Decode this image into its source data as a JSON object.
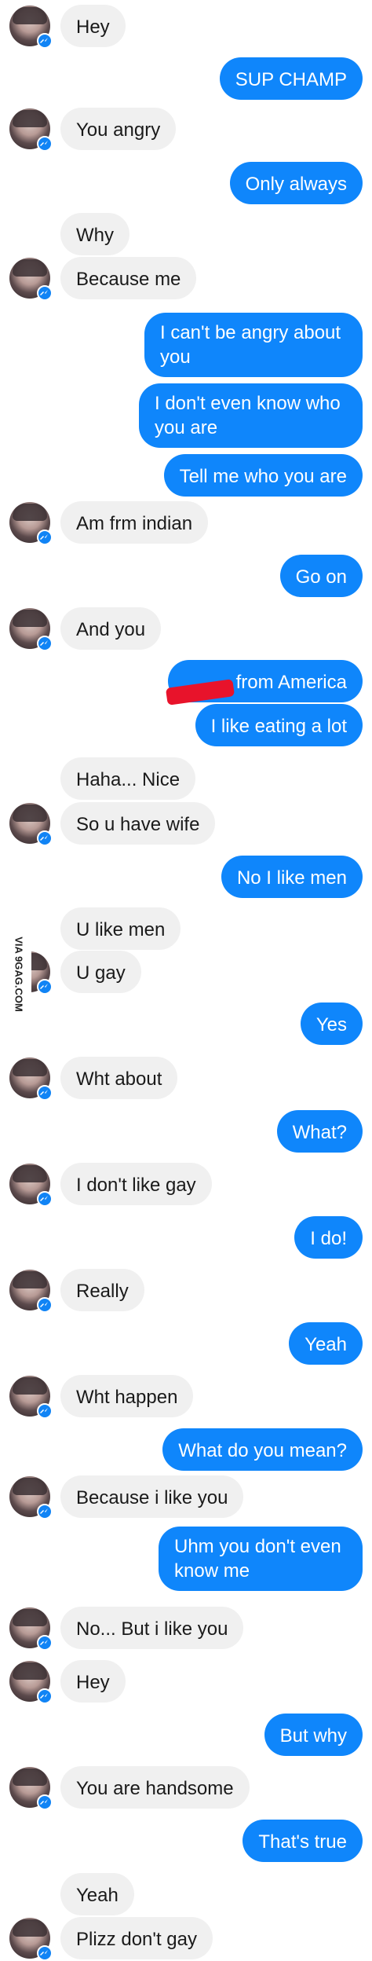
{
  "messages": [
    {
      "side": "in",
      "text": "Hey",
      "avatar": true
    },
    {
      "side": "out",
      "text": "SUP CHAMP"
    },
    {
      "side": "in",
      "text": "You angry",
      "avatar": true
    },
    {
      "side": "out",
      "text": "Only always"
    },
    {
      "side": "in",
      "text": "Why",
      "avatar": false
    },
    {
      "side": "in",
      "text": "Because me",
      "avatar": true
    },
    {
      "side": "out",
      "text": "I can't be angry about you"
    },
    {
      "side": "out",
      "text": "I don't even know who you are"
    },
    {
      "side": "out",
      "text": "Tell me who you are"
    },
    {
      "side": "in",
      "text": "Am frm indian",
      "avatar": true
    },
    {
      "side": "out",
      "text": "Go on"
    },
    {
      "side": "in",
      "text": "And you",
      "avatar": true
    },
    {
      "side": "out",
      "text": "from America"
    },
    {
      "side": "out",
      "text": "I like eating a lot"
    },
    {
      "side": "in",
      "text": "Haha... Nice",
      "avatar": false
    },
    {
      "side": "in",
      "text": "So u have wife",
      "avatar": true
    },
    {
      "side": "out",
      "text": "No I like men"
    },
    {
      "side": "in",
      "text": "U like men",
      "avatar": false
    },
    {
      "side": "in",
      "text": "U gay",
      "avatar": true
    },
    {
      "side": "out",
      "text": "Yes"
    },
    {
      "side": "in",
      "text": "Wht about",
      "avatar": true
    },
    {
      "side": "out",
      "text": "What?"
    },
    {
      "side": "in",
      "text": "I don't like gay",
      "avatar": true
    },
    {
      "side": "out",
      "text": "I do!"
    },
    {
      "side": "in",
      "text": "Really",
      "avatar": true
    },
    {
      "side": "out",
      "text": "Yeah"
    },
    {
      "side": "in",
      "text": "Wht happen",
      "avatar": true
    },
    {
      "side": "out",
      "text": "What do you mean?"
    },
    {
      "side": "in",
      "text": "Because i like you",
      "avatar": true
    },
    {
      "side": "out",
      "text": "Uhm you don't even know me"
    },
    {
      "side": "in",
      "text": "No... But i like you",
      "avatar": true
    },
    {
      "side": "in",
      "text": "Hey",
      "avatar": true
    },
    {
      "side": "out",
      "text": "But why"
    },
    {
      "side": "in",
      "text": "You are handsome",
      "avatar": true
    },
    {
      "side": "out",
      "text": "That's true"
    },
    {
      "side": "in",
      "text": "Yeah",
      "avatar": false
    },
    {
      "side": "in",
      "text": "Plizz don't gay",
      "avatar": true
    }
  ],
  "watermark": "VIA 9GAG.COM",
  "colors": {
    "outgoing_bubble": "#0f86fb",
    "incoming_bubble": "#f0f0f0",
    "badge": "#1184f5",
    "redaction": "#e8132b"
  },
  "icons": {
    "avatar": "user-avatar",
    "badge": "messenger-badge-icon"
  }
}
